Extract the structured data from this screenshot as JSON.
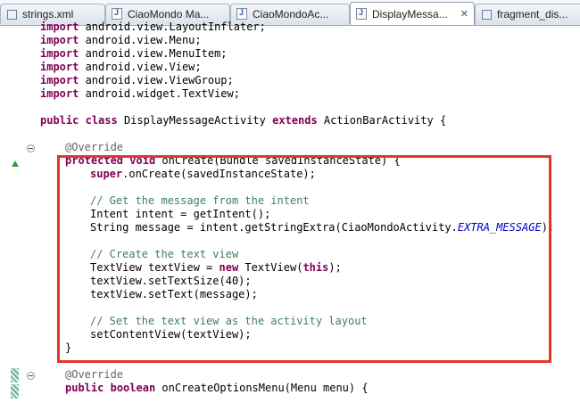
{
  "tabs": [
    {
      "label": "strings.xml",
      "icon": "xml-file-icon",
      "active": false
    },
    {
      "label": "CiaoMondo Ma...",
      "icon": "java-file-icon",
      "active": false
    },
    {
      "label": "CiaoMondoAc...",
      "icon": "java-file-icon",
      "active": false
    },
    {
      "label": "DisplayMessa...",
      "icon": "java-file-icon",
      "active": true,
      "close": "✕"
    },
    {
      "label": "fragment_dis...",
      "icon": "xml-file-icon",
      "active": false
    }
  ],
  "code": {
    "l1": {
      "kw": "import",
      "rest": " android.view.LayoutInflater;"
    },
    "l2": {
      "kw": "import",
      "rest": " android.view.Menu;"
    },
    "l3": {
      "kw": "import",
      "rest": " android.view.MenuItem;"
    },
    "l4": {
      "kw": "import",
      "rest": " android.view.View;"
    },
    "l5": {
      "kw": "import",
      "rest": " android.view.ViewGroup;"
    },
    "l6": {
      "kw": "import",
      "rest": " android.widget.TextView;"
    },
    "l7": {
      "kw1": "public",
      "kw2": "class",
      "name": " DisplayMessageActivity ",
      "kw3": "extends",
      "rest": " ActionBarActivity {"
    },
    "l8": {
      "annotation": "@Override"
    },
    "l9": {
      "kw1": "protected",
      "kw2": "void",
      "rest": " onCreate(Bundle savedInstanceState) {"
    },
    "l10": {
      "kw": "super",
      "rest": ".onCreate(savedInstanceState);"
    },
    "l11": {
      "comment": "// Get the message from the intent"
    },
    "l12": {
      "text": "Intent intent = getIntent();"
    },
    "l13": {
      "pre": "String message = intent.getStringExtra(CiaoMondoActivity.",
      "static": "EXTRA_MESSAGE",
      "post": ");"
    },
    "l14": {
      "comment": "// Create the text view"
    },
    "l15": {
      "pre": "TextView textView = ",
      "kw1": "new",
      "mid": " TextView(",
      "kw2": "this",
      "post": ");"
    },
    "l16": {
      "text": "textView.setTextSize(40);"
    },
    "l17": {
      "text": "textView.setText(message);"
    },
    "l18": {
      "comment": "// Set the text view as the activity layout"
    },
    "l19": {
      "text": "setContentView(textView);"
    },
    "l20": {
      "text": "}"
    },
    "l21": {
      "annotation": "@Override"
    },
    "l22": {
      "kw1": "public",
      "kw2": "boolean",
      "rest": " onCreateOptionsMenu(Menu menu) {"
    }
  },
  "colors": {
    "keyword": "#7f0055",
    "comment": "#3f7f5f",
    "annotation": "#646464",
    "static_field": "#0000c0",
    "highlight_border": "#e0382a"
  }
}
